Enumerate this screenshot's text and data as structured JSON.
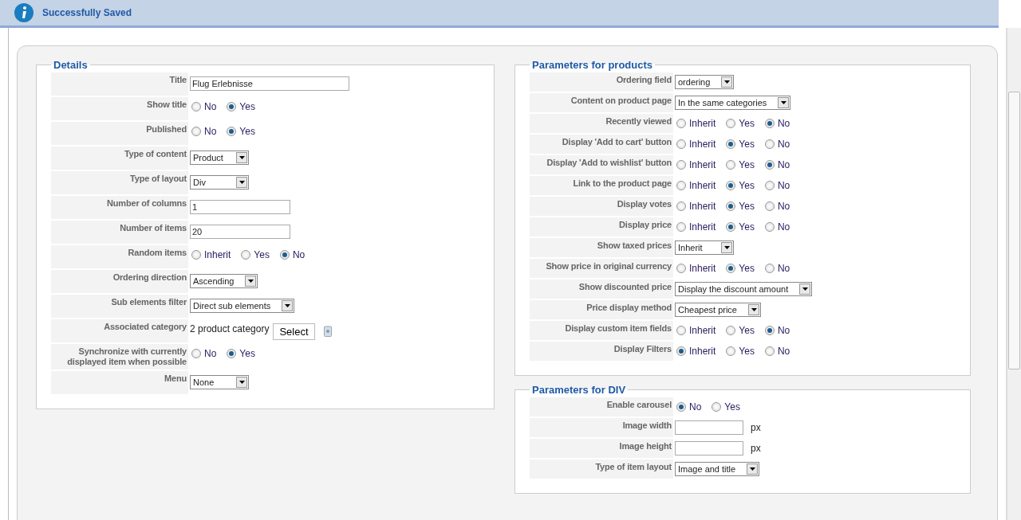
{
  "message": {
    "text": "Successfully Saved"
  },
  "details": {
    "legend": "Details",
    "rows": [
      {
        "label": "Title",
        "kind": "text",
        "value": "Flug Erlebnisse"
      },
      {
        "label": "Show title",
        "kind": "radio",
        "options": [
          {
            "label": "No",
            "selected": false
          },
          {
            "label": "Yes",
            "selected": true
          }
        ]
      },
      {
        "label": "Published",
        "kind": "radio",
        "options": [
          {
            "label": "No",
            "selected": false
          },
          {
            "label": "Yes",
            "selected": true
          }
        ]
      },
      {
        "label": "Type of content",
        "kind": "select",
        "value": "Product"
      },
      {
        "label": "Type of layout",
        "kind": "select",
        "value": "Div"
      },
      {
        "label": "Number of columns",
        "kind": "number",
        "value": "1"
      },
      {
        "label": "Number of items",
        "kind": "number",
        "value": "20"
      },
      {
        "label": "Random items",
        "kind": "radio",
        "options": [
          {
            "label": "Inherit",
            "selected": false
          },
          {
            "label": "Yes",
            "selected": false
          },
          {
            "label": "No",
            "selected": true
          }
        ]
      },
      {
        "label": "Ordering direction",
        "kind": "select",
        "value": "Ascending"
      },
      {
        "label": "Sub elements filter",
        "kind": "select",
        "value": "Direct sub elements"
      },
      {
        "label": "Associated category",
        "kind": "category",
        "value": "2 product category",
        "button": "Select"
      },
      {
        "label": "Synchronize with currently displayed item when possible",
        "kind": "radio",
        "options": [
          {
            "label": "No",
            "selected": false
          },
          {
            "label": "Yes",
            "selected": true
          }
        ]
      },
      {
        "label": "Menu",
        "kind": "select",
        "value": "None"
      }
    ]
  },
  "products": {
    "legend": "Parameters for products",
    "rows": [
      {
        "label": "Ordering field",
        "kind": "select",
        "value": "ordering"
      },
      {
        "label": "Content on product page",
        "kind": "select",
        "value": "In the same categories"
      },
      {
        "label": "Recently viewed",
        "kind": "radio",
        "options": [
          {
            "label": "Inherit",
            "selected": false
          },
          {
            "label": "Yes",
            "selected": false
          },
          {
            "label": "No",
            "selected": true
          }
        ]
      },
      {
        "label": "Display 'Add to cart' button",
        "kind": "radio",
        "options": [
          {
            "label": "Inherit",
            "selected": false
          },
          {
            "label": "Yes",
            "selected": true
          },
          {
            "label": "No",
            "selected": false
          }
        ]
      },
      {
        "label": "Display 'Add to wishlist' button",
        "kind": "radio",
        "options": [
          {
            "label": "Inherit",
            "selected": false
          },
          {
            "label": "Yes",
            "selected": false
          },
          {
            "label": "No",
            "selected": true
          }
        ]
      },
      {
        "label": "Link to the product page",
        "kind": "radio",
        "options": [
          {
            "label": "Inherit",
            "selected": false
          },
          {
            "label": "Yes",
            "selected": true
          },
          {
            "label": "No",
            "selected": false
          }
        ]
      },
      {
        "label": "Display votes",
        "kind": "radio",
        "options": [
          {
            "label": "Inherit",
            "selected": false
          },
          {
            "label": "Yes",
            "selected": true
          },
          {
            "label": "No",
            "selected": false
          }
        ]
      },
      {
        "label": "Display price",
        "kind": "radio",
        "options": [
          {
            "label": "Inherit",
            "selected": false
          },
          {
            "label": "Yes",
            "selected": true
          },
          {
            "label": "No",
            "selected": false
          }
        ]
      },
      {
        "label": "Show taxed prices",
        "kind": "select",
        "value": "Inherit"
      },
      {
        "label": "Show price in original currency",
        "kind": "radio",
        "options": [
          {
            "label": "Inherit",
            "selected": false
          },
          {
            "label": "Yes",
            "selected": true
          },
          {
            "label": "No",
            "selected": false
          }
        ]
      },
      {
        "label": "Show discounted price",
        "kind": "select",
        "value": "Display the discount amount"
      },
      {
        "label": "Price display method",
        "kind": "select",
        "value": "Cheapest price"
      },
      {
        "label": "Display custom item fields",
        "kind": "radio",
        "options": [
          {
            "label": "Inherit",
            "selected": false
          },
          {
            "label": "Yes",
            "selected": false
          },
          {
            "label": "No",
            "selected": true
          }
        ]
      },
      {
        "label": "Display Filters",
        "kind": "radio",
        "options": [
          {
            "label": "Inherit",
            "selected": true
          },
          {
            "label": "Yes",
            "selected": false
          },
          {
            "label": "No",
            "selected": false
          }
        ]
      }
    ]
  },
  "div_params": {
    "legend": "Parameters for DIV",
    "rows": [
      {
        "label": "Enable carousel",
        "kind": "radio",
        "options": [
          {
            "label": "No",
            "selected": true
          },
          {
            "label": "Yes",
            "selected": false
          }
        ]
      },
      {
        "label": "Image width",
        "kind": "px",
        "unit": "px"
      },
      {
        "label": "Image height",
        "kind": "px",
        "unit": "px"
      },
      {
        "label": "Type of item layout",
        "kind": "select",
        "value": "Image and title"
      }
    ]
  }
}
